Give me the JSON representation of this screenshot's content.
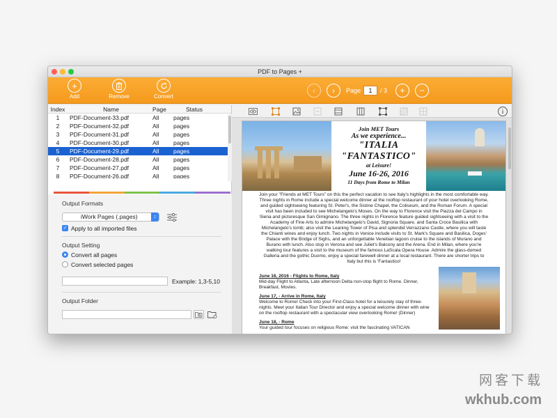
{
  "window": {
    "title": "PDF to Pages +"
  },
  "toolbar": {
    "add_label": "Add",
    "remove_label": "Remove",
    "convert_label": "Convert",
    "page_label": "Page",
    "page_current": "1",
    "page_total": "/ 3"
  },
  "file_table": {
    "headers": {
      "index": "Index",
      "name": "Name",
      "page": "Page",
      "status": "Status"
    },
    "rows": [
      {
        "index": "1",
        "name": "PDF-Document-33.pdf",
        "page": "All",
        "status": "pages"
      },
      {
        "index": "2",
        "name": "PDF-Document-32.pdf",
        "page": "All",
        "status": "pages"
      },
      {
        "index": "3",
        "name": "PDF-Document-31.pdf",
        "page": "All",
        "status": "pages"
      },
      {
        "index": "4",
        "name": "PDF-Document-30.pdf",
        "page": "All",
        "status": "pages"
      },
      {
        "index": "5",
        "name": "PDF-Document-29.pdf",
        "page": "All",
        "status": "pages",
        "selected": true
      },
      {
        "index": "6",
        "name": "PDF-Document-28.pdf",
        "page": "All",
        "status": "pages"
      },
      {
        "index": "7",
        "name": "PDF-Document-27.pdf",
        "page": "All",
        "status": "pages"
      },
      {
        "index": "8",
        "name": "PDF-Document-26.pdf",
        "page": "All",
        "status": "pages"
      }
    ]
  },
  "settings": {
    "output_formats_title": "Output Formats",
    "format_selected": "iWork Pages (.pages)",
    "apply_all_label": "Apply to all imported files",
    "output_setting_title": "Output Setting",
    "convert_all_label": "Convert all pages",
    "convert_selected_label": "Convert selected pages",
    "range_example": "Example: 1,3-5,10",
    "output_folder_title": "Output Folder"
  },
  "preview": {
    "title_lines": [
      "Join MET Tours",
      "As we experience...",
      "\"ITALIA",
      "\"FANTASTICO\"",
      "at Leisure!",
      "June 16-26, 2016",
      "11 Days from Rome to Milan"
    ],
    "intro_paragraph": "Join your \"Friends at MET Tours\" on this the perfect vacation to see Italy's highlights in the most comfortable way. Three nights in Rome include a special welcome dinner at the rooftop restaurant of your hotel overlooking Rome, and guided sightseeing featuring St. Peter's, the Sistine Chapel, the Coliseum, and the Roman Forum. A special visit has been included to see Michelangelo's Moses. On the way to Florence visit the Piazza del Campo in Siena and picturesque San Gimignano. The three nights in Florence feature guided sightseeing with a visit to the Academy of Fine Arts to admire Michelangelo's David, Signoria Square, and Santa Croce Basilica with Michelangelo's tomb; also visit the Leaning Tower of Pisa and splendid Verrazzano Castle, where you will taste the Chianti wines and enjoy lunch. Two nights in Venice include visits to St. Mark's Square and Basilica, Doges' Palace with the Bridge of Sighs, and an unforgettable Venetian lagoon cruise to the islands of Murano and Burano with lunch. Also stop in Verona and see Juliet's Balcony and the Arena. End in Milan, where you're walking tour features a visit to the museum of the famous LaScala Opera House. Admire the glass-domed Galleria and the gothic Duomo, enjoy a special farewell dinner at a local restaurant. There are shorter trips to Italy but this is 'Fantastico!",
    "itinerary": [
      {
        "heading": "June 16, 2016 - Flights to Rome, Italy",
        "text": "Mid-day Flight to Atlanta, Late afternoon Delta non-stop flight to Rome. Dinner, Breakfast, Movies."
      },
      {
        "heading": "June 17, - Arrive in Rome, Italy",
        "text": "Welcome to Rome! Check into your First-Class hotel for a leisurely stay of three-nights. Meet your Italian Tour Director and enjoy a special welcome dinner with wine on the rooftop restaurant with a spectacular view overlooking Rome! (Dinner)"
      },
      {
        "heading": "June 18, - Rome",
        "text": "Your guided tour focuses on religious Rome: visit the fascinating VATICAN"
      }
    ]
  },
  "watermark": {
    "line1": "网客下载",
    "line2": "wkhub.com"
  },
  "colors": {
    "accent_orange": "#f8a328",
    "selection_blue": "#1b62d1",
    "control_blue": "#3b86f0"
  }
}
